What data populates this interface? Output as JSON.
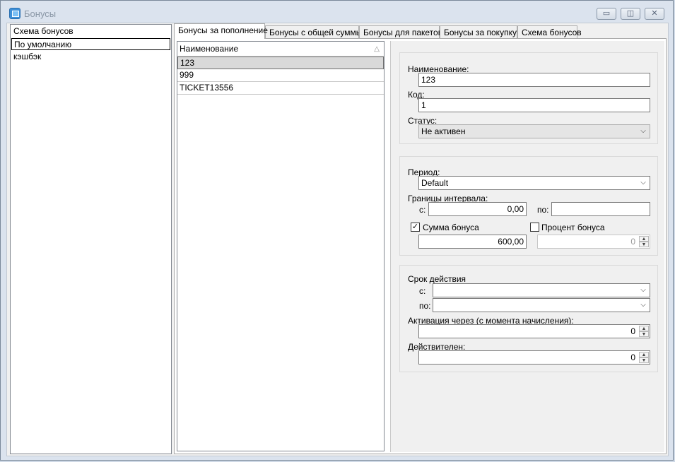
{
  "window": {
    "title": "Бонусы",
    "minimize": "▭",
    "maximize": "◫",
    "close": "✕"
  },
  "left_list": {
    "items": [
      {
        "label": "Схема бонусов"
      },
      {
        "label": "По умолчанию",
        "selected": true
      },
      {
        "label": "кэшбэк"
      }
    ]
  },
  "tabs": [
    {
      "label": "Бонусы за пополнение",
      "active": true
    },
    {
      "label": "Бонусы с общей суммы"
    },
    {
      "label": "Бонусы для пакетов"
    },
    {
      "label": "Бонусы за покупку"
    },
    {
      "label": "Схема бонусов"
    }
  ],
  "grid": {
    "header": "Наименование",
    "sort_icon": "△",
    "rows": [
      "123",
      "999",
      "TICKET13556"
    ]
  },
  "form": {
    "name_label": "Наименование:",
    "name_value": "123",
    "code_label": "Код:",
    "code_value": "1",
    "status_label": "Статус:",
    "status_value": "Не активен",
    "period_label": "Период:",
    "period_value": "Default",
    "bounds_label": "Границы интервала:",
    "from_label": "с:",
    "from_value": "0,00",
    "to_label": "по:",
    "to_value": "",
    "bonus_sum_label": "Сумма бонуса",
    "bonus_sum_checked": true,
    "bonus_sum_value": "600,00",
    "bonus_percent_label": "Процент бонуса",
    "bonus_percent_checked": false,
    "bonus_percent_value": "0",
    "validity_label": "Срок действия",
    "validity_from_label": "с:",
    "validity_to_label": "по:",
    "activation_label": "Активация через (с момента начисления):",
    "activation_value": "0",
    "valid_label": "Действителен:",
    "valid_value": "0"
  },
  "glyphs": {
    "dropdown": "⌵",
    "check": "✓",
    "spin_up": "▲",
    "spin_down": "▼"
  }
}
